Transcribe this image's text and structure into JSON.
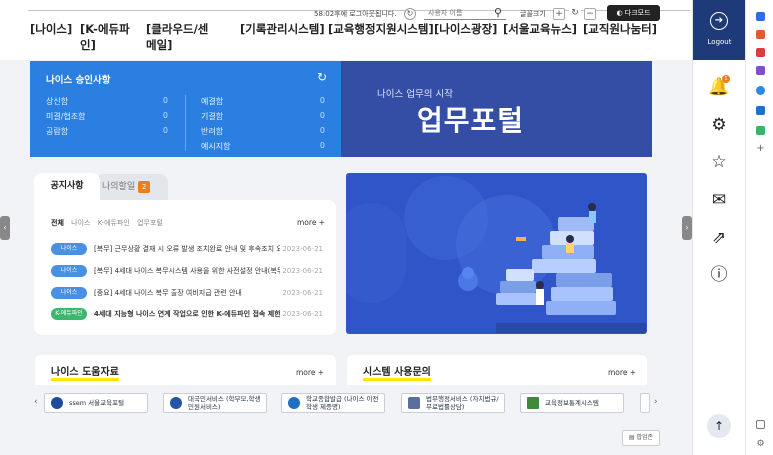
{
  "header": {
    "session_text": "58:02후에 로그아웃됩니다.",
    "session_refresh": "↻",
    "search_placeholder": "사용자 이름",
    "font_size_label": "글꼴크기",
    "font_plus": "+",
    "font_reset": "↻",
    "font_minus": "−",
    "dark_mode_label": "다크모드",
    "nav": [
      "[나이스]",
      "[K-에듀파인]",
      "[클라우드/센메일]",
      "[기록관리시스템]",
      "[교육행정지원시스템]",
      "[나이스광장]",
      "[서울교육뉴스]",
      "[교직원나눔터]"
    ]
  },
  "approval": {
    "title": "나이스 승인사항",
    "left": [
      {
        "label": "상신함",
        "value": "0"
      },
      {
        "label": "미결/협조함",
        "value": "0"
      },
      {
        "label": "공람함",
        "value": "0"
      }
    ],
    "right": [
      {
        "label": "예결함",
        "value": "0"
      },
      {
        "label": "기결함",
        "value": "0"
      },
      {
        "label": "반려함",
        "value": "0"
      },
      {
        "label": "예시지함",
        "value": "0"
      }
    ]
  },
  "portal": {
    "subtitle": "나이스 업무의 시작",
    "title": "업무포털"
  },
  "notice": {
    "tab_active": "공지사항",
    "tab_inactive": "나의할일",
    "tab_badge": "2",
    "subtabs": [
      "전체",
      "나이스",
      "K-에듀파인",
      "업무포털"
    ],
    "more": "more +",
    "items": [
      {
        "tag": "나이스",
        "text": "[복무] 근무상황 결재 시 오류 발생 조치완료 안내 및 후속조치 요청",
        "date": "2023-06-21",
        "bold": false,
        "green": false
      },
      {
        "tag": "나이스",
        "text": "[복무] 4세대 나이스 복무시스템 사용을 위한 사전설정 안내(복무...",
        "date": "2023-06-21",
        "bold": false,
        "green": false
      },
      {
        "tag": "나이스",
        "text": "[중요] 4세대 나이스 복무 출장 여비지급 관련 안내",
        "date": "2023-06-21",
        "bold": false,
        "green": false
      },
      {
        "tag": "K-에듀파인",
        "text": "4세대 지능형 나이스 연계 작업으로 인한 K-에듀파인 접속 제한...",
        "date": "2023-06-21",
        "bold": true,
        "green": true
      }
    ]
  },
  "help": {
    "title": "나이스 도움자료",
    "more": "more +"
  },
  "inquiry": {
    "title": "시스템 사용문의",
    "more": "more +"
  },
  "banners": {
    "prev": "‹",
    "next": "›",
    "items": [
      {
        "name": "ssem 서울교육포털",
        "color": "#1d4aa0"
      },
      {
        "name": "대국민서비스 (학부모,학생 민원서비스)",
        "color": "#2355a8"
      },
      {
        "name": "학교종합발급 (나이스 이전 학생 제증명)",
        "color": "#1f6fc2"
      },
      {
        "name": "법무행정서비스 (자치법규/무료법률상담)",
        "color": "#5a6fa0"
      },
      {
        "name": "교육정보통계시스템",
        "color": "#3f8a3a"
      }
    ]
  },
  "site_map_label": "팝업존",
  "right_panel": {
    "logout_label": "Logout",
    "notification_count": "1",
    "icons": [
      "bell-icon",
      "gear-icon",
      "star-icon",
      "briefcase-icon",
      "share-icon",
      "info-icon"
    ],
    "top_label": "↑"
  },
  "colors": {
    "approval_bg": "#2a7fe0",
    "portal_bg": "#334ea4",
    "illustration_bg": "#2f55c8",
    "logout_bg": "#1e3a78",
    "accent_orange": "#f07d1b"
  }
}
